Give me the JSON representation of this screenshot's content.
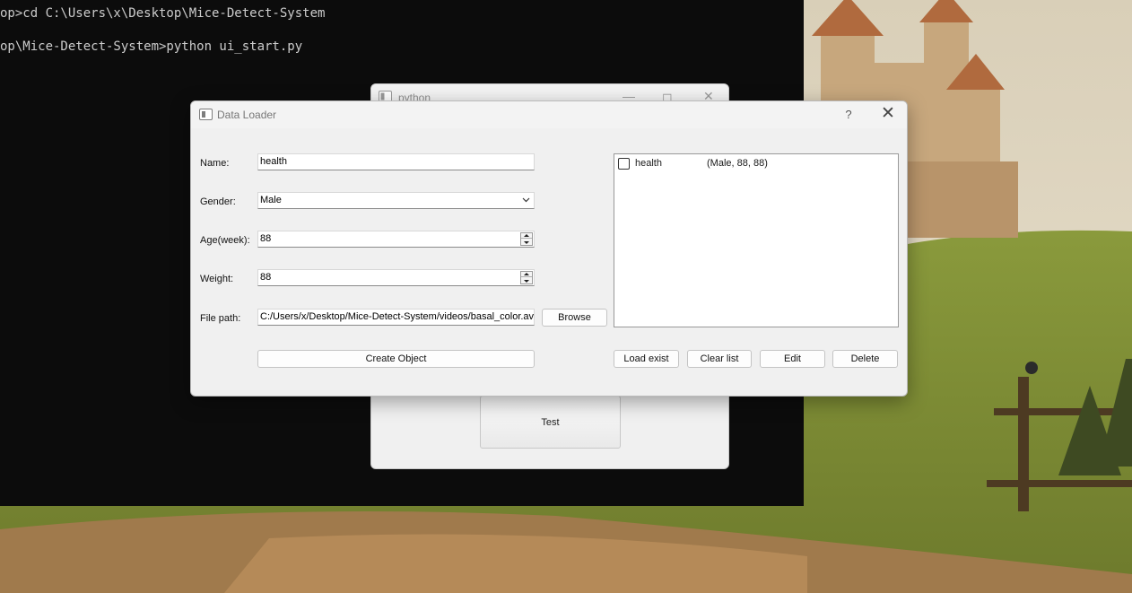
{
  "terminal": {
    "lines": [
      "op>cd C:\\Users\\x\\Desktop\\Mice-Detect-System",
      "op\\Mice-Detect-System>python ui_start.py"
    ]
  },
  "python_window": {
    "title": "python",
    "test_button_label": "Test"
  },
  "dialog": {
    "title": "Data Loader",
    "help_label": "?",
    "close_label": "✕",
    "form": {
      "name_label": "Name:",
      "name_value": "health",
      "gender_label": "Gender:",
      "gender_value": "Male",
      "age_label": "Age(week):",
      "age_value": "88",
      "weight_label": "Weight:",
      "weight_value": "88",
      "file_path_label": "File path:",
      "file_path_value": "C:/Users/x/Desktop/Mice-Detect-System/videos/basal_color.avi",
      "browse_label": "Browse",
      "create_label": "Create Object"
    },
    "list": {
      "items": [
        {
          "name": "health",
          "details": "(Male, 88, 88)",
          "checked": false
        }
      ]
    },
    "actions": {
      "load_exist": "Load exist",
      "clear_list": "Clear list",
      "edit": "Edit",
      "delete": "Delete"
    }
  },
  "colors": {
    "terminal_bg": "#0c0c0c",
    "terminal_text": "#cccccc",
    "dialog_bg": "#f0f0f0",
    "titlebar_text": "#777777"
  },
  "icons": [
    "window-app-icon",
    "minimize-icon",
    "maximize-icon",
    "close-icon",
    "help-icon",
    "chevron-down-icon",
    "spin-up-icon",
    "spin-down-icon",
    "checkbox-icon"
  ]
}
